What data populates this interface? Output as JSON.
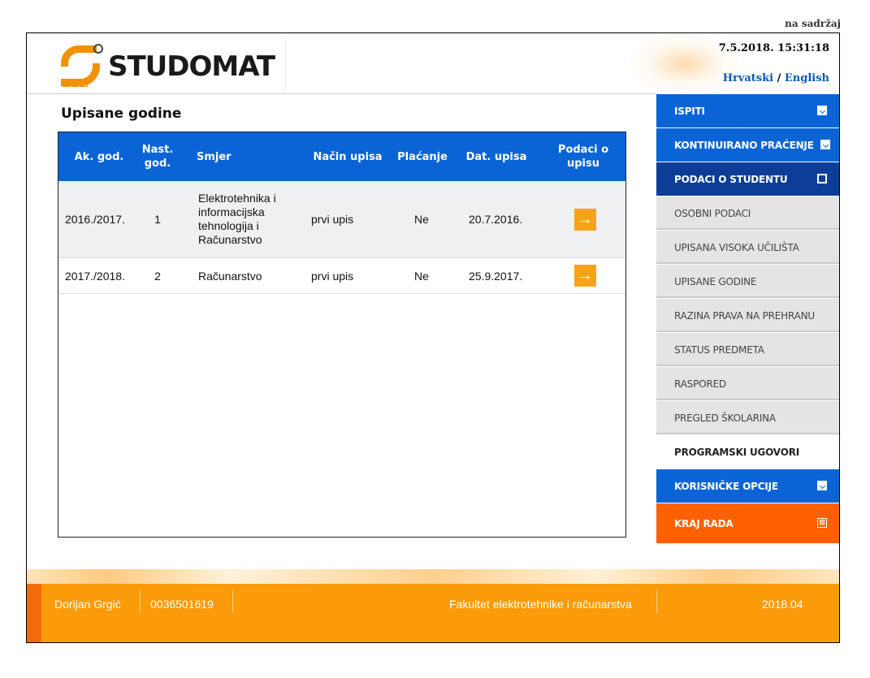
{
  "skip_link": "na sadržaj",
  "header": {
    "logo_text": "STUDOMAT",
    "datetime": "7.5.2018. 15:31:18",
    "lang_hr": "Hrvatski",
    "lang_sep": "/",
    "lang_en": "English"
  },
  "page_title": "Upisane godine",
  "table": {
    "headers": {
      "ak_god": "Ak. god.",
      "nast_god": "Nast. god.",
      "smjer": "Smjer",
      "nacin": "Način upisa",
      "placanje": "Plaćanje",
      "datum": "Dat. upisa",
      "podaci": "Podaci o upisu"
    },
    "rows": [
      {
        "ak_god": "2016./2017.",
        "nast_god": "1",
        "smjer": "Elektrotehnika i informacijska tehnologija i Računarstvo",
        "nacin": "prvi upis",
        "placanje": "Ne",
        "datum": "20.7.2016.",
        "arrow": "→"
      },
      {
        "ak_god": "2017./2018.",
        "nast_god": "2",
        "smjer": "Računarstvo",
        "nacin": "prvi upis",
        "placanje": "Ne",
        "datum": "25.9.2017.",
        "arrow": "→"
      }
    ]
  },
  "menu": {
    "ispiti": "ISPITI",
    "kontinuirano": "KONTINUIRANO PRAĆENJE",
    "podaci_o_studentu": "PODACI O STUDENTU",
    "sub": [
      "OSOBNI PODACI",
      "UPISANA VISOKA UČILIŠTA",
      "UPISANE GODINE",
      "RAZINA PRAVA NA PREHRANU",
      "STATUS PREDMETA",
      "RASPORED",
      "PREGLED ŠKOLARINA",
      "PROGRAMSKI UGOVORI"
    ],
    "korisnicke": "KORISNIČKE OPCIJE",
    "kraj": "KRAJ RADA",
    "close_glyph": "⊠"
  },
  "footer": {
    "name": "Dorijan Grgić",
    "jmbag": "0036501619",
    "faculty": "Fakultet elektrotehnike i računarstva",
    "version": "2018.04"
  },
  "colors": {
    "blue": "#0a64d6",
    "dark_blue": "#0c3e97",
    "orange": "#fc9b09",
    "red_orange": "#ff6000"
  }
}
